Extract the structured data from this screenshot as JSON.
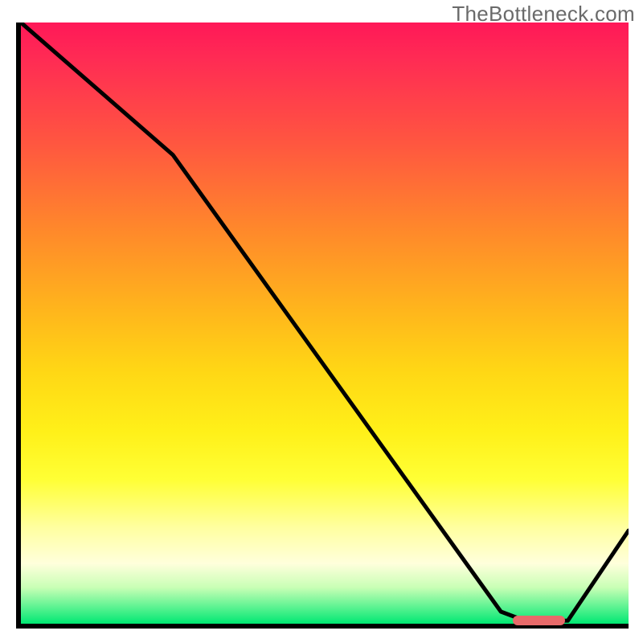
{
  "watermark": "TheBottleneck.com",
  "chart_data": {
    "type": "line",
    "title": "",
    "xlabel": "",
    "ylabel": "",
    "xlim": [
      0,
      100
    ],
    "ylim": [
      0,
      100
    ],
    "grid": false,
    "curve_points": [
      {
        "x": 0,
        "y": 100
      },
      {
        "x": 25,
        "y": 78
      },
      {
        "x": 79,
        "y": 2
      },
      {
        "x": 83,
        "y": 0.5
      },
      {
        "x": 90,
        "y": 0.5
      },
      {
        "x": 100,
        "y": 15.5
      }
    ],
    "marker": {
      "x_start": 81,
      "x_end": 89.5,
      "y": 0.5,
      "color": "#e86a6a"
    },
    "background_gradient": {
      "top": "#ff1858",
      "mid_upper": "#ffb61c",
      "mid": "#fff019",
      "mid_lower": "#ffffdc",
      "bottom": "#00e873"
    }
  }
}
